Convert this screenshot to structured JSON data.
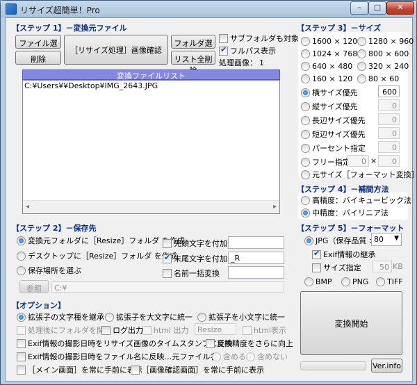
{
  "window": {
    "title": "リサイズ超簡単！Pro",
    "min_label": "–",
    "max_label": "□",
    "close_label": "✕"
  },
  "step1": {
    "heading": "【ステップ 1】－変換元ファイル",
    "select_file": "ファイル選択",
    "delete": "削除",
    "resize_button": "［リサイズ処理］画像確認",
    "select_folder": "フォルダ選択",
    "clear_list": "リスト全削除",
    "include_subfolders": "サブフォルダも対象",
    "full_path": "フルパス表示",
    "processed_label": "処理画像：",
    "processed_count": "1",
    "list_header": "変換ファイルリスト",
    "files": [
      "C:¥Users¥¥Desktop¥IMG_2643.JPG"
    ]
  },
  "step3": {
    "heading": "【ステップ 3】－サイズ",
    "sizes": [
      "1600 × 1200",
      "1280 × 960",
      "1024 × 768",
      "800 × 600",
      "640 × 480",
      "320 × 240",
      "160 × 120",
      "80 × 60"
    ],
    "width_priority": "横サイズ優先",
    "width_value": "600",
    "height_priority": "縦サイズ優先",
    "height_value": "0",
    "long_priority": "長辺サイズ優先",
    "long_value": "0",
    "short_priority": "短辺サイズ優先",
    "short_value": "0",
    "percent": "パーセント指定",
    "percent_value": "0",
    "free": "フリー指定",
    "free_w": "0",
    "free_x": "×",
    "free_h": "0",
    "original": "元サイズ［フォーマット変換］"
  },
  "step4": {
    "heading": "【ステップ 4】－補間方法",
    "high": "高精度：バイキュービック法",
    "mid": "中精度：バイリニア法"
  },
  "step2": {
    "heading": "【ステップ 2】－保存先",
    "opt1": "変換元フォルダに［Resize］フォルダ を作成",
    "opt2": "デスクトップに［Resize］フォルダ を作成",
    "opt3": "保存場所を選ぶ",
    "browse": "参照",
    "path": "C:¥",
    "prefix": "先頭文字を付加",
    "prefix_value": "",
    "suffix": "末尾文字を付加",
    "suffix_value": "_R",
    "rename": "名前一括変換",
    "rename_value": ""
  },
  "step5": {
    "heading": "【ステップ 5】－フォーマット",
    "jpg": "JPG（保存品質 >",
    "quality": "80",
    "exif": "Exif情報の継承",
    "size_limit": "サイズ指定",
    "size_value": "50",
    "size_unit": "KB",
    "bmp": "BMP",
    "png": "PNG",
    "tiff": "TIFF",
    "convert": "変換開始",
    "version": "Ver.info"
  },
  "options": {
    "heading": "【オプション】",
    "keep_ext": "拡張子の文字種を継承",
    "upper_ext": "拡張子を大文字に統一",
    "lower_ext": "拡張子を小文字に統一",
    "open_folder": "処理後にフォルダを開く",
    "log": "ログ出力",
    "html_out": "html 出力",
    "resize_field": "Resize",
    "html_show": "html表示",
    "exif_timestamp": "Exif情報の撮影日時をリサイズ画像のタイムスタンプに反映",
    "improve": "変換精度をさらに向上",
    "exif_filename": "Exif情報の撮影日時をファイル名に反映…元ファイル名：",
    "include": "含める",
    "exclude": "含めない",
    "main_front": "［メイン画面］を常に手前に表示",
    "preview_front": "［画像確認画面］を常に手前に表示"
  }
}
